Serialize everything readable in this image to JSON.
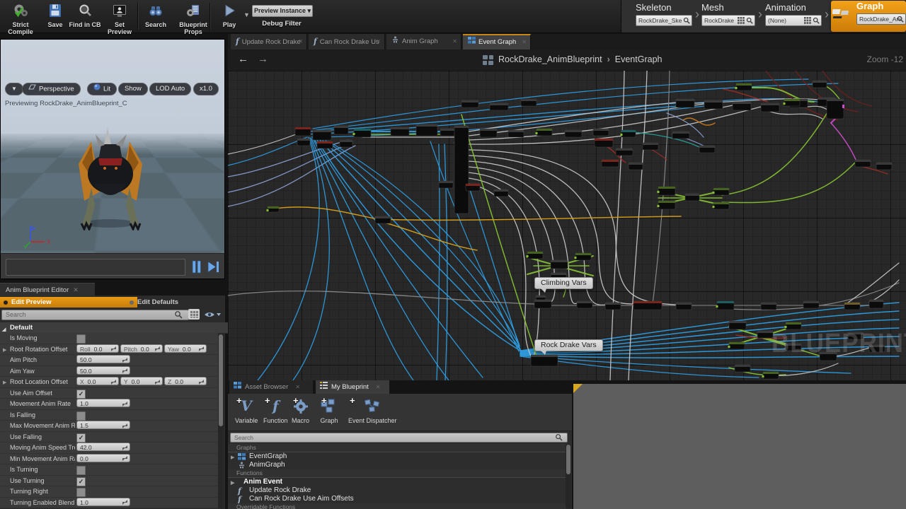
{
  "toolbar": {
    "buttons": [
      {
        "label": "Strict Compile",
        "icon": "gears-check"
      },
      {
        "label": "Save",
        "icon": "floppy"
      },
      {
        "label": "Find in CB",
        "icon": "magnifier"
      },
      {
        "label": "Set Preview",
        "icon": "person-monitor"
      },
      {
        "label": "Search",
        "icon": "binoculars"
      },
      {
        "label": "Blueprint Props",
        "icon": "gear-doc"
      },
      {
        "label": "Play",
        "icon": "play"
      }
    ],
    "preview_instance_label": "Preview Instance",
    "debug_filter_label": "Debug Filter"
  },
  "asset_nav": {
    "items": [
      {
        "title": "Skeleton",
        "value": "RockDrake_Ske",
        "grid_icon": false,
        "active": false
      },
      {
        "title": "Mesh",
        "value": "RockDrake",
        "grid_icon": true,
        "active": false
      },
      {
        "title": "Animation",
        "value": "(None)",
        "grid_icon": true,
        "active": false
      },
      {
        "title": "Graph",
        "value": "RockDrake_Ani",
        "grid_icon": false,
        "active": true
      }
    ]
  },
  "viewport": {
    "toolbar": [
      {
        "label": "",
        "icon": "caret"
      },
      {
        "label": "Perspective",
        "icon": "persp"
      },
      {
        "label": "Lit",
        "icon": "lit"
      },
      {
        "label": "Show",
        "icon": ""
      },
      {
        "label": "LOD Auto",
        "icon": ""
      },
      {
        "label": "x1.0",
        "icon": ""
      }
    ],
    "previewing_text": "Previewing RockDrake_AnimBlueprint_C"
  },
  "anim_bp_editor": {
    "tab_label": "Anim Blueprint Editor",
    "edit_preview_label": "Edit Preview",
    "edit_defaults_label": "Edit Defaults",
    "search_placeholder": "Search",
    "section_label": "Default",
    "properties": [
      {
        "label": "Is Moving",
        "type": "checkbox",
        "checked": false
      },
      {
        "label": "Root Rotation Offset",
        "type": "vector",
        "expandable": true,
        "fields": [
          {
            "name": "Roll",
            "value": "0.0"
          },
          {
            "name": "Pitch",
            "value": "0.0"
          },
          {
            "name": "Yaw",
            "value": "0.0"
          }
        ]
      },
      {
        "label": "Aim Pitch",
        "type": "number",
        "value": "50.0"
      },
      {
        "label": "Aim Yaw",
        "type": "number",
        "value": "50.0"
      },
      {
        "label": "Root Location Offset",
        "type": "vector",
        "expandable": true,
        "fields": [
          {
            "name": "X",
            "value": "0.0"
          },
          {
            "name": "Y",
            "value": "0.0"
          },
          {
            "name": "Z",
            "value": "0.0"
          }
        ]
      },
      {
        "label": "Use Aim Offset",
        "type": "checkbox",
        "checked": true
      },
      {
        "label": "Movement Anim Rate",
        "type": "number",
        "value": "1.0"
      },
      {
        "label": "Is Falling",
        "type": "checkbox",
        "checked": false
      },
      {
        "label": "Max Movement Anim Rat",
        "type": "number",
        "value": "1.5"
      },
      {
        "label": "Use Falling",
        "type": "checkbox",
        "checked": true
      },
      {
        "label": "Moving Anim Speed Tresh",
        "type": "number",
        "value": "42.0"
      },
      {
        "label": "Min Movement Anim Rate",
        "type": "number",
        "value": "0.0"
      },
      {
        "label": "Is Turning",
        "type": "checkbox",
        "checked": false
      },
      {
        "label": "Use Turning",
        "type": "checkbox",
        "checked": true
      },
      {
        "label": "Turning Right",
        "type": "checkbox",
        "checked": false
      },
      {
        "label": "Turning Enabled Blend Tin",
        "type": "number",
        "value": "1.0"
      }
    ]
  },
  "graph_panel": {
    "tabs": [
      {
        "label": "Update Rock Drake",
        "icon": "function",
        "active": false
      },
      {
        "label": "Can Rock Drake Us",
        "icon": "function",
        "active": false
      },
      {
        "label": "Anim Graph",
        "icon": "animgraph",
        "active": false
      },
      {
        "label": "Event Graph",
        "icon": "eventgraph",
        "active": true
      }
    ],
    "back_arrow": "←",
    "forward_arrow": "→",
    "breadcrumb": {
      "root": "RockDrake_AnimBlueprint",
      "separator": "›",
      "current": "EventGraph"
    },
    "zoom_label": "Zoom -12",
    "comments": {
      "climbing": "Climbing Vars",
      "rockdrake": "Rock Drake Vars"
    },
    "watermark": "BLUEPRINT"
  },
  "my_blueprint": {
    "tabs": [
      {
        "label": "Asset Browser",
        "icon": "eventgraph",
        "active": false
      },
      {
        "label": "My Blueprint",
        "icon": "list",
        "active": true
      }
    ],
    "actions": [
      {
        "label": "Variable",
        "icon": "var"
      },
      {
        "label": "Function",
        "icon": "func"
      },
      {
        "label": "Macro",
        "icon": "macro"
      },
      {
        "label": "Graph",
        "icon": "graph-cubes"
      },
      {
        "label": "Event Dispatcher",
        "icon": "dispatcher"
      }
    ],
    "search_placeholder": "Search",
    "sections": [
      {
        "label": "Graphs",
        "items": [
          {
            "label": "EventGraph",
            "icon": "eventgraph",
            "expandable": true,
            "bold": false
          },
          {
            "label": "AnimGraph",
            "icon": "animgraph",
            "expandable": false,
            "bold": false
          }
        ]
      },
      {
        "label": "Functions",
        "items": [
          {
            "label": "Anim Event",
            "icon": "",
            "expandable": true,
            "bold": true
          },
          {
            "label": "Update Rock Drake",
            "icon": "function",
            "expandable": false,
            "bold": false
          },
          {
            "label": "Can Rock Drake Use Aim Offsets",
            "icon": "function",
            "expandable": false,
            "bold": false
          }
        ]
      },
      {
        "label": "Overridable Functions",
        "items": []
      }
    ]
  },
  "colors": {
    "accent_orange": "#E8930C",
    "tab_highlight": "#C8861A",
    "wire_blue": "#2E9FE6",
    "wire_green": "#86C232",
    "wire_yellow": "#D9A21B",
    "wire_orange": "#C87A1A",
    "wire_white": "#C9C9C9",
    "wire_gray": "#8E8E8E",
    "wire_red": "#9E2B25",
    "wire_darkred": "#6E1F1C",
    "wire_periwinkle": "#8C9FD4",
    "wire_magenta": "#CC4DCC",
    "wire_teal": "#2AA198"
  }
}
